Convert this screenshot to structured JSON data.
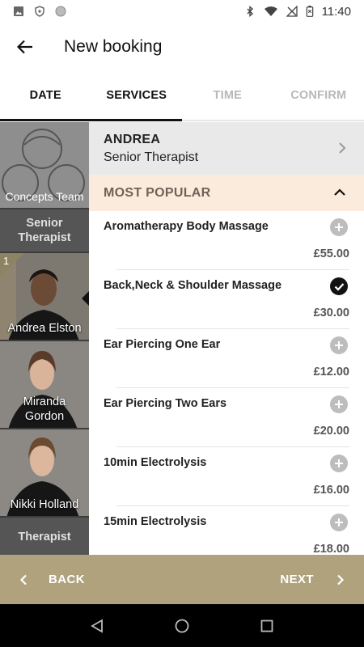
{
  "status_bar": {
    "time": "11:40"
  },
  "app_bar": {
    "title": "New booking"
  },
  "tabs": [
    {
      "label": "DATE",
      "enabled": true
    },
    {
      "label": "SERVICES",
      "enabled": true,
      "active": true
    },
    {
      "label": "TIME",
      "enabled": false
    },
    {
      "label": "CONFIRM",
      "enabled": false
    }
  ],
  "staff_column": {
    "team_label": "Concepts Team",
    "section_senior": "Senior\nTherapist",
    "staff": [
      {
        "name": "Andrea Elston",
        "badge": "1",
        "selected": true
      },
      {
        "name": "Miranda\nGordon"
      },
      {
        "name": "Nikki Holland"
      }
    ],
    "section_therapist": "Therapist"
  },
  "therapist_header": {
    "name": "ANDREA",
    "role": "Senior Therapist"
  },
  "category": {
    "title": "MOST POPULAR",
    "expanded": true
  },
  "services": [
    {
      "name": "Aromatherapy Body Massage",
      "price": "£55.00",
      "selected": false
    },
    {
      "name": "Back,Neck & Shoulder Massage",
      "price": "£30.00",
      "selected": true
    },
    {
      "name": "Ear Piercing One Ear",
      "price": "£12.00",
      "selected": false
    },
    {
      "name": "Ear Piercing Two Ears",
      "price": "£20.00",
      "selected": false
    },
    {
      "name": "10min Electrolysis",
      "price": "£16.00",
      "selected": false
    },
    {
      "name": "15min Electrolysis",
      "price": "£18.00",
      "selected": false
    }
  ],
  "bottom_bar": {
    "back_label": "BACK",
    "next_label": "NEXT"
  },
  "colors": {
    "accent": "#b0a27d",
    "category_bg": "#faebdc",
    "selected": "#111111",
    "unselected": "#bdbdbd"
  },
  "icons": [
    "gallery-icon",
    "shield-icon",
    "circle-icon",
    "bluetooth-icon",
    "wifi-icon",
    "no-signal-icon",
    "battery-icon",
    "back-arrow-icon",
    "chevron-right-icon",
    "chevron-up-icon",
    "add-icon",
    "check-icon",
    "chevron-left-icon",
    "nav-back-icon",
    "nav-home-icon",
    "nav-recents-icon"
  ]
}
